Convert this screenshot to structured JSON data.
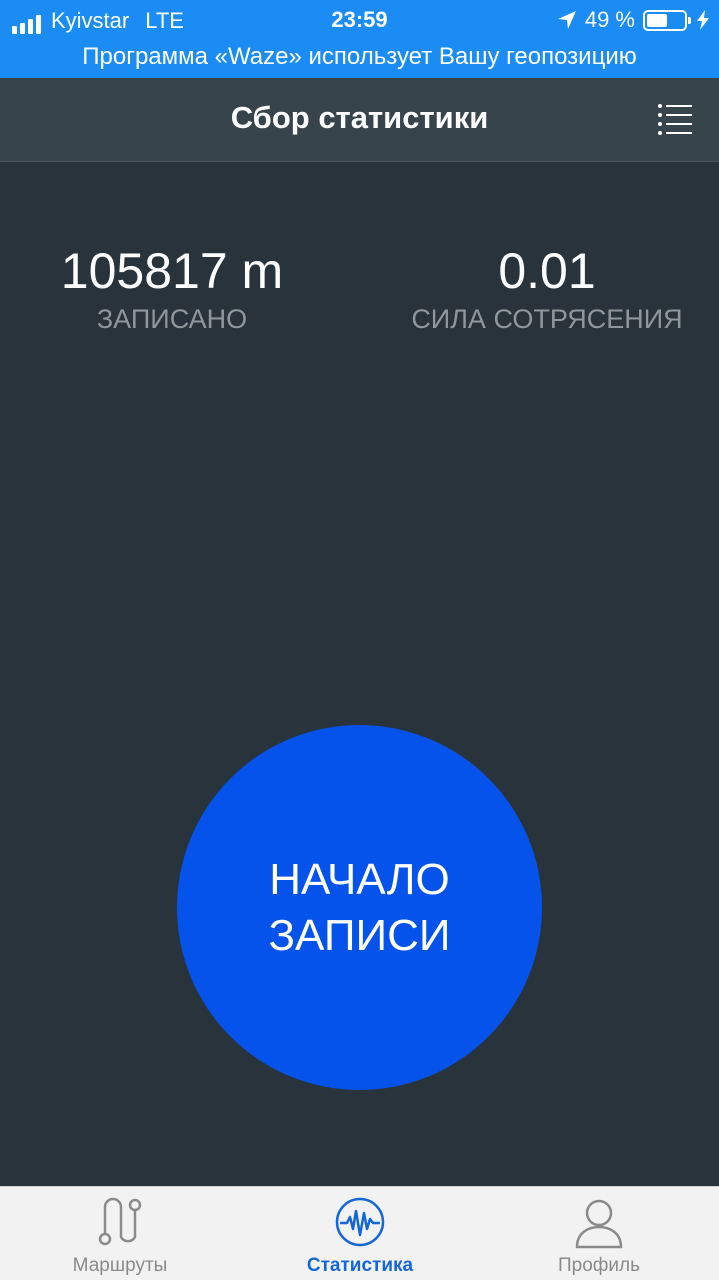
{
  "status_bar": {
    "carrier": "Kyivstar",
    "network": "LTE",
    "time": "23:59",
    "battery": "49 %"
  },
  "location_banner": {
    "text": "Программа «Waze» использует Вашу геопозицию"
  },
  "header": {
    "title": "Сбор статистики",
    "menu_icon": "list-menu-icon"
  },
  "stats": {
    "recorded_value": "105817 m",
    "recorded_label": "ЗАПИСАНО",
    "shake_value": "0.01",
    "shake_label": "СИЛА СОТРЯСЕНИЯ"
  },
  "record_button": {
    "line1": "НАЧАЛО",
    "line2": "ЗАПИСИ",
    "color": "#0553ea"
  },
  "tabs": [
    {
      "label": "Маршруты",
      "icon": "route-icon",
      "active": false
    },
    {
      "label": "Статистика",
      "icon": "waveform-icon",
      "active": true
    },
    {
      "label": "Профиль",
      "icon": "profile-icon",
      "active": false
    }
  ],
  "colors": {
    "status_bar": "#1a8cf4",
    "header": "#37444c",
    "background": "#29333b",
    "active_tab": "#1566d6"
  }
}
